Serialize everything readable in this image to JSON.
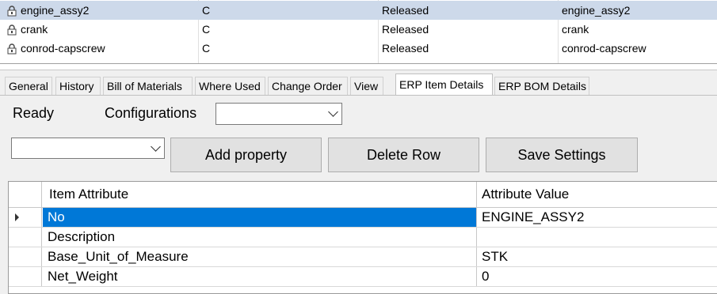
{
  "items": [
    {
      "name": "engine_assy2",
      "revision": "C",
      "state": "Released",
      "number": "engine_assy2",
      "selected": true
    },
    {
      "name": "crank",
      "revision": "C",
      "state": "Released",
      "number": "crank",
      "selected": false
    },
    {
      "name": "conrod-capscrew",
      "revision": "C",
      "state": "Released",
      "number": "conrod-capscrew",
      "selected": false
    }
  ],
  "tabs": [
    "General",
    "History",
    "Bill of Materials",
    "Where Used",
    "Change Order",
    "View",
    "ERP Item Details",
    "ERP BOM Details"
  ],
  "active_tab": "ERP Item Details",
  "status": "Ready",
  "config_label": "Configurations",
  "config_value": "",
  "property_combo_value": "",
  "buttons": {
    "add": "Add property",
    "delete": "Delete Row",
    "save": "Save Settings"
  },
  "grid": {
    "headers": [
      "Item Attribute",
      "Attribute Value"
    ],
    "rows": [
      {
        "attribute": "No",
        "value": "ENGINE_ASSY2"
      },
      {
        "attribute": "Description",
        "value": ""
      },
      {
        "attribute": "Base_Unit_of_Measure",
        "value": "STK"
      },
      {
        "attribute": "Net_Weight",
        "value": "0"
      }
    ]
  },
  "colors": {
    "selection": "#0078d7",
    "row_highlight": "#cdd9ea"
  },
  "icons": {
    "lock": "lock-icon",
    "dropdown": "chevron-down-icon",
    "current_row": "row-pointer-icon"
  }
}
